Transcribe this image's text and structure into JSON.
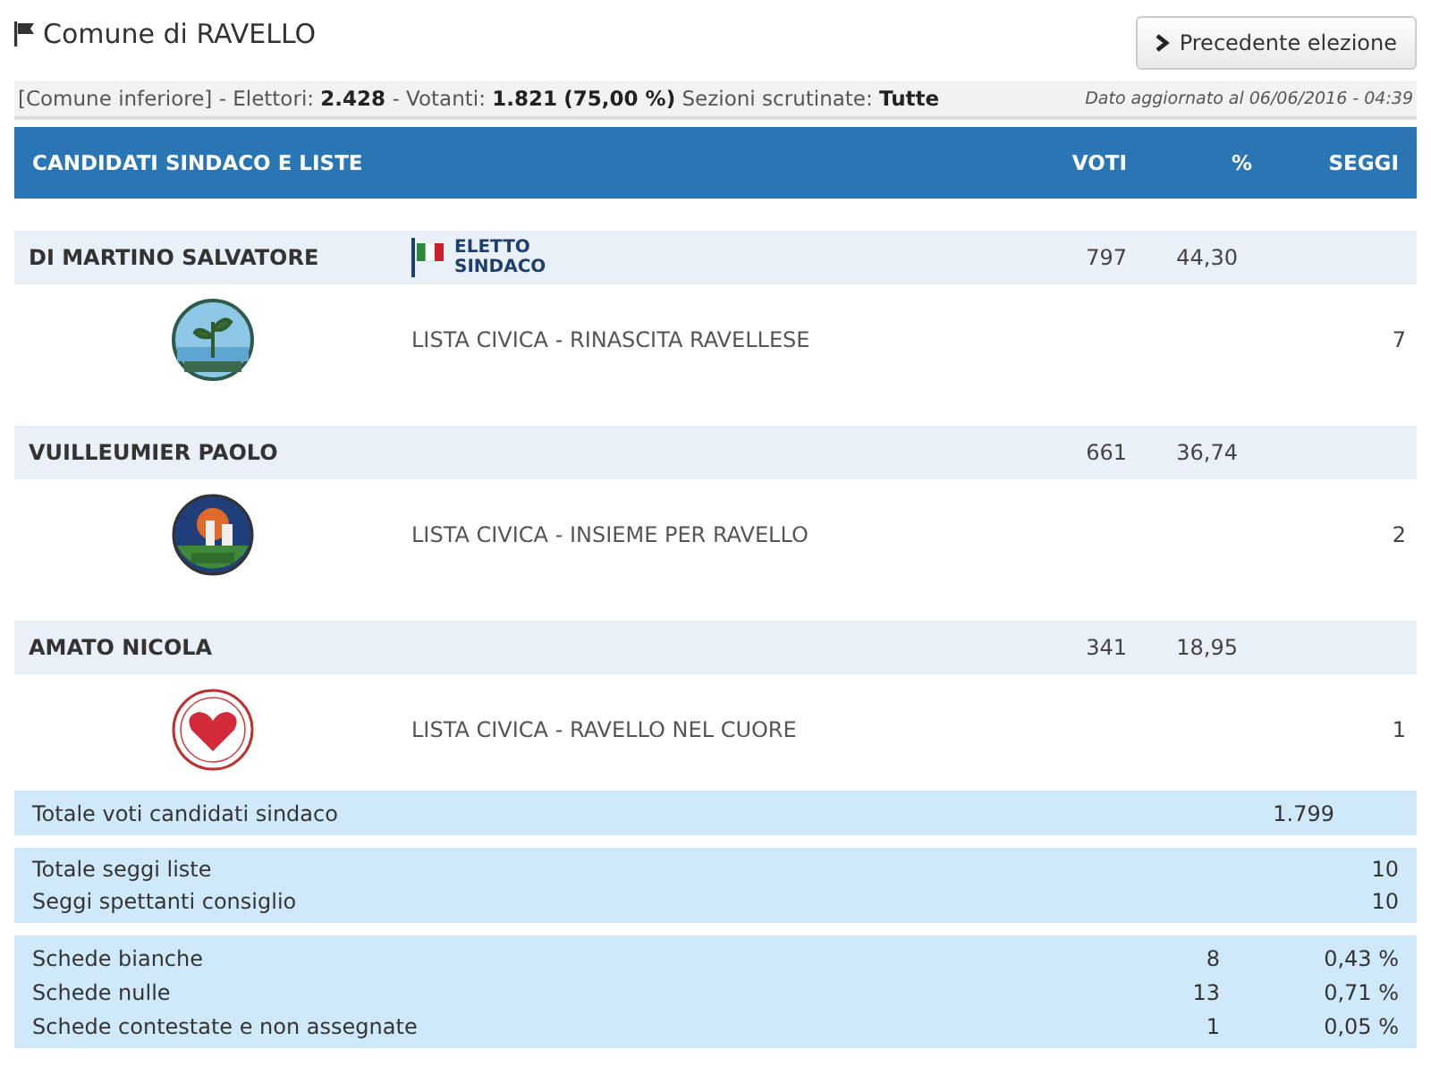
{
  "title": "Comune di RAVELLO",
  "previous_button": "Precedente elezione",
  "info": {
    "prefix": "[Comune inferiore] - Elettori: ",
    "electors": "2.428",
    "voters_label": " - Votanti: ",
    "voters": "1.821",
    "voters_pct": "(75,00 %)",
    "sections_label": " Sezioni scrutinate: ",
    "sections": "Tutte",
    "updated": "Dato aggiornato al 06/06/2016 - 04:39"
  },
  "table_header": {
    "candidates": "CANDIDATI SINDACO E LISTE",
    "votes": "VOTI",
    "pct": "%",
    "seats": "SEGGI"
  },
  "candidates": [
    {
      "name": "DI MARTINO SALVATORE",
      "elected": true,
      "elected_label": "ELETTO SINDACO",
      "votes": "797",
      "pct": "44,30",
      "lists": [
        {
          "kind": "sprout",
          "name": "LISTA CIVICA - RINASCITA RAVELLESE",
          "seats": "7"
        }
      ]
    },
    {
      "name": "VUILLEUMIER PAOLO",
      "elected": false,
      "votes": "661",
      "pct": "36,74",
      "lists": [
        {
          "kind": "town",
          "name": "LISTA CIVICA - INSIEME PER RAVELLO",
          "seats": "2"
        }
      ]
    },
    {
      "name": "AMATO NICOLA",
      "elected": false,
      "votes": "341",
      "pct": "18,95",
      "lists": [
        {
          "kind": "heart",
          "name": "LISTA CIVICA - RAVELLO NEL CUORE",
          "seats": "1"
        }
      ]
    }
  ],
  "total_votes": {
    "label": "Totale voti candidati sindaco",
    "value": "1.799"
  },
  "seats_summary": [
    {
      "label": "Totale seggi liste",
      "value": "10"
    },
    {
      "label": "Seggi spettanti consiglio",
      "value": "10"
    }
  ],
  "ballots": [
    {
      "label": "Schede bianche",
      "count": "8",
      "pct": "0,43 %"
    },
    {
      "label": "Schede nulle",
      "count": "13",
      "pct": "0,71 %"
    },
    {
      "label": "Schede contestate e non assegnate",
      "count": "1",
      "pct": "0,05 %"
    }
  ]
}
